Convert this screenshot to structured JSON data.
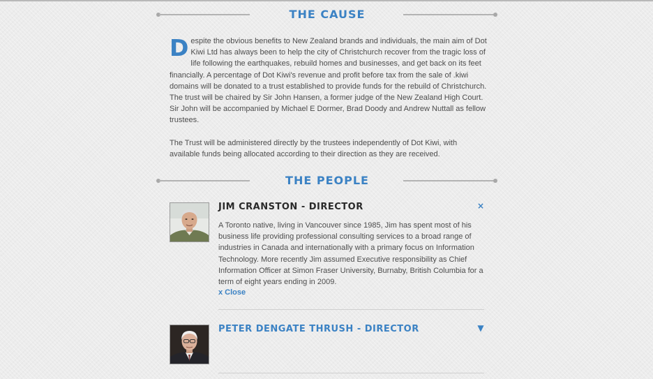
{
  "cause": {
    "title": "THE CAUSE",
    "dropcap": "D",
    "paragraph1": "espite the obvious benefits to New Zealand brands and individuals, the main aim of Dot Kiwi Ltd has always been to help the city of Christchurch recover from the tragic loss of life following the earthquakes, rebuild homes and businesses, and get back on its feet financially. A percentage of Dot Kiwi's revenue and profit before tax from the sale of .kiwi domains will be donated to a trust established to provide funds for the rebuild of Christchurch. The trust will be chaired by Sir John Hansen, a former judge of the New Zealand High Court. Sir John will be accompanied by Michael E Dormer, Brad Doody and Andrew Nuttall as fellow trustees.",
    "paragraph2": "The Trust will be administered directly by the trustees independently of Dot Kiwi, with available funds being allocated according to their direction as they are received."
  },
  "people": {
    "title": "THE PEOPLE",
    "members": [
      {
        "name": "JIM CRANSTON - DIRECTOR",
        "toggle_icon": "close-x-icon",
        "toggle_glyph": "×",
        "expanded": true,
        "bio": "A Toronto native, living in Vancouver since 1985, Jim has spent most of his business life providing professional consulting services to a broad range of industries in Canada and internationally with a primary focus on Information Technology. More recently Jim assumed Executive responsibility as Chief Information Officer at Simon Fraser University, Burnaby, British Columbia for a term of eight years ending in 2009.",
        "close_label": "x Close"
      },
      {
        "name": "PETER DENGATE THRUSH - DIRECTOR",
        "toggle_icon": "expand-triangle-icon",
        "toggle_glyph": "▼",
        "expanded": false
      }
    ]
  },
  "colors": {
    "accent": "#3b82c4",
    "heading_dark": "#2a2a2a",
    "body_text": "#4d4d4d",
    "background": "#ececec"
  }
}
